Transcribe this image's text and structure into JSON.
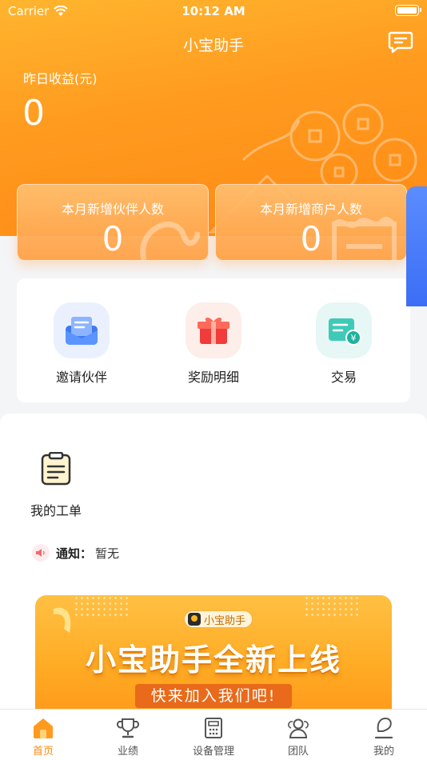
{
  "status_bar": {
    "carrier": "Carrier",
    "time": "10:12 AM"
  },
  "header": {
    "title": "小宝助手",
    "earnings_label": "昨日收益(元)",
    "earnings_value": "0"
  },
  "stats": [
    {
      "label": "本月新增伙伴人数",
      "value": "0"
    },
    {
      "label": "本月新增商户人数",
      "value": "0"
    }
  ],
  "quick_actions": [
    {
      "label": "邀请伙伴",
      "icon": "invite-envelope-icon"
    },
    {
      "label": "奖励明细",
      "icon": "gift-box-icon"
    },
    {
      "label": "交易",
      "icon": "transaction-card-icon"
    }
  ],
  "work_order": {
    "label": "我的工单",
    "icon": "clipboard-icon"
  },
  "notice": {
    "key": "通知：",
    "value": "暂无"
  },
  "banner": {
    "badge": "小宝助手",
    "title": "小宝助手全新上线",
    "subtitle": "快来加入我们吧!"
  },
  "tabs": [
    {
      "label": "首页",
      "icon": "home-icon",
      "active": true
    },
    {
      "label": "业绩",
      "icon": "trophy-icon",
      "active": false
    },
    {
      "label": "设备管理",
      "icon": "device-icon",
      "active": false
    },
    {
      "label": "团队",
      "icon": "team-icon",
      "active": false
    },
    {
      "label": "我的",
      "icon": "profile-icon",
      "active": false
    }
  ],
  "colors": {
    "brand": "#ff9a1f",
    "tab_active": "#ff8a14"
  }
}
